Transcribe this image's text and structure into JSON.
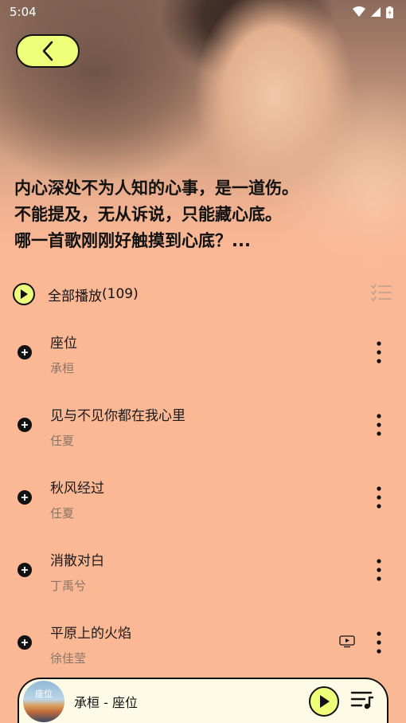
{
  "status_bar": {
    "time": "5:04"
  },
  "hero": {
    "lines": [
      "内心深处不为人知的心事，是一道伤。",
      "不能提及，无从诉说，只能藏心底。",
      "哪一首歌刚刚好触摸到心底？..."
    ]
  },
  "play_all": {
    "label": "全部播放",
    "count": "(109)"
  },
  "songs": [
    {
      "title": "座位",
      "artist": "承桓",
      "has_mv": false
    },
    {
      "title": "见与不见你都在我心里",
      "artist": "任夏",
      "has_mv": false
    },
    {
      "title": "秋风经过",
      "artist": "任夏",
      "has_mv": false
    },
    {
      "title": "消散对白",
      "artist": "丁禹兮",
      "has_mv": false
    },
    {
      "title": "平原上的火焰",
      "artist": "徐佳莹",
      "has_mv": true
    }
  ],
  "mini_player": {
    "now_playing": "承桓 - 座位",
    "album_art_text": "座位"
  },
  "colors": {
    "accent": "#eeff7a",
    "background": "#fbb895",
    "text": "#111111",
    "muted": "#8a7566"
  }
}
